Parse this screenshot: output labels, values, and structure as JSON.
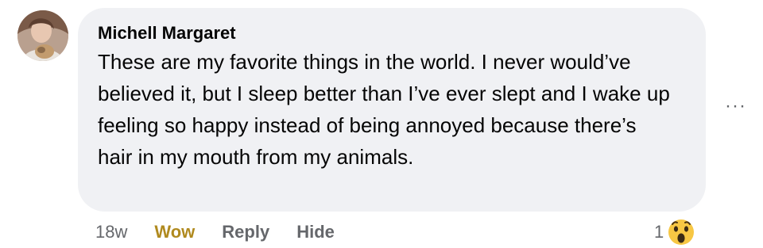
{
  "comment": {
    "author": "Michell Margaret",
    "text": "These are my favorite things in the world. I never would’ve believed it, but I sleep better than I’ve ever slept and I wake up feeling so happy instead of being annoyed because there’s hair in my mouth from my animals.",
    "more_glyph": "···"
  },
  "actions": {
    "time": "18w",
    "reaction_label": "Wow",
    "reply_label": "Reply",
    "hide_label": "Hide"
  },
  "reactions": {
    "count": "1",
    "icon": "wow-emoji-icon"
  },
  "colors": {
    "bubble": "#f0f1f4",
    "wow_accent": "#b08a1f",
    "secondary_text": "#65676b",
    "emoji_yellow": "#f7c744"
  }
}
